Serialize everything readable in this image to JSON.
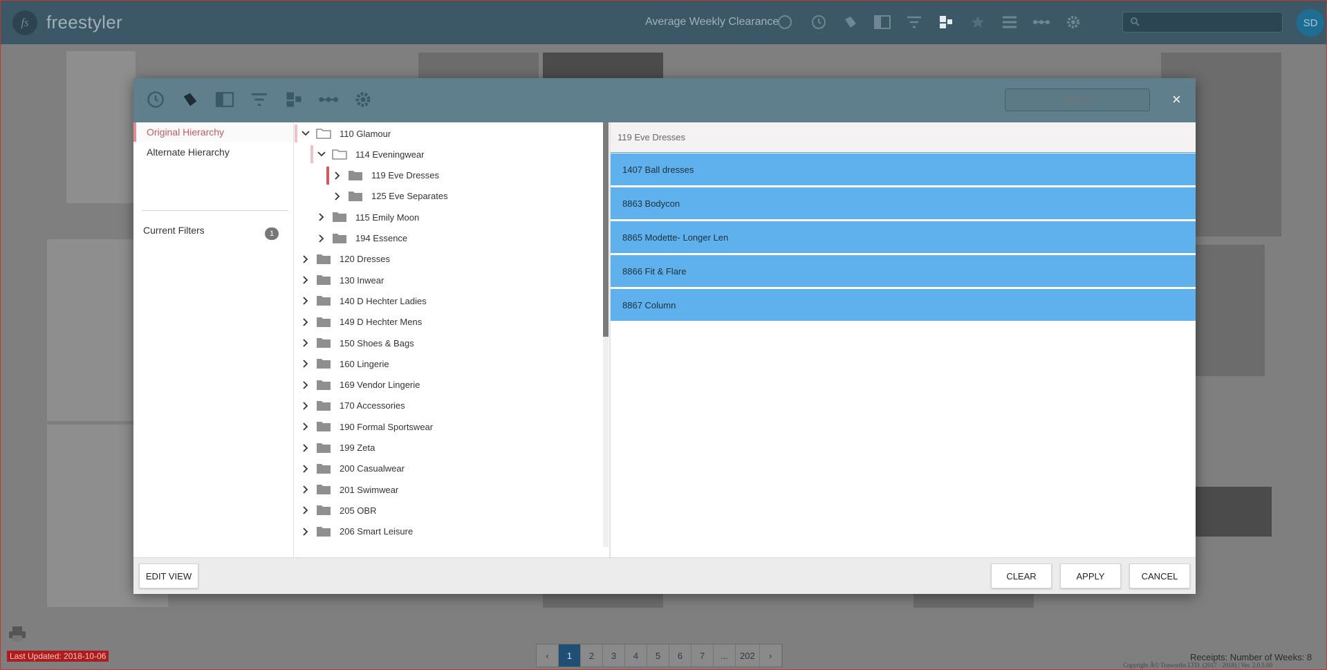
{
  "app": {
    "logo_text": "fs",
    "title": "freestyler",
    "metric_label": "Average Weekly Clearance",
    "user_initials": "SD"
  },
  "modal": {
    "search_placeholder": "Search",
    "close_label": "×",
    "sidebar": [
      {
        "label": "Original Hierarchy",
        "active": true
      },
      {
        "label": "Alternate Hierarchy",
        "active": false
      }
    ],
    "current_filters_label": "Current Filters",
    "current_filters_count": "1",
    "tree": [
      {
        "label": "110 Glamour",
        "level": 0,
        "expanded": true
      },
      {
        "label": "114 Eveningwear",
        "level": 1,
        "expanded": true
      },
      {
        "label": "119 Eve Dresses",
        "level": 2,
        "expanded": false,
        "selected": true
      },
      {
        "label": "125 Eve Separates",
        "level": 2,
        "expanded": false
      },
      {
        "label": "115 Emily Moon",
        "level": 1,
        "expanded": false
      },
      {
        "label": "194 Essence",
        "level": 1,
        "expanded": false
      },
      {
        "label": "120 Dresses",
        "level": 0,
        "expanded": false
      },
      {
        "label": "130 Inwear",
        "level": 0,
        "expanded": false
      },
      {
        "label": "140 D Hechter Ladies",
        "level": 0,
        "expanded": false
      },
      {
        "label": "149 D Hechter Mens",
        "level": 0,
        "expanded": false
      },
      {
        "label": "150 Shoes & Bags",
        "level": 0,
        "expanded": false
      },
      {
        "label": "160 Lingerie",
        "level": 0,
        "expanded": false
      },
      {
        "label": "169 Vendor Lingerie",
        "level": 0,
        "expanded": false
      },
      {
        "label": "170 Accessories",
        "level": 0,
        "expanded": false
      },
      {
        "label": "190 Formal Sportswear",
        "level": 0,
        "expanded": false
      },
      {
        "label": "199 Zeta",
        "level": 0,
        "expanded": false
      },
      {
        "label": "200 Casualwear",
        "level": 0,
        "expanded": false
      },
      {
        "label": "201 Swimwear",
        "level": 0,
        "expanded": false
      },
      {
        "label": "205 OBR",
        "level": 0,
        "expanded": false
      },
      {
        "label": "206 Smart Leisure",
        "level": 0,
        "expanded": false
      }
    ],
    "detail_header": "119 Eve Dresses",
    "detail_items": [
      "1407 Ball dresses",
      "8863 Bodycon",
      "8865 Modette- Longer Len",
      "8866 Fit & Flare",
      "8867 Column"
    ],
    "buttons": {
      "edit_view": "EDIT VIEW",
      "clear": "CLEAR",
      "apply": "APPLY",
      "cancel": "CANCEL"
    }
  },
  "footer": {
    "last_updated": "Last Updated: 2018-10-06",
    "pages": [
      "‹",
      "1",
      "2",
      "3",
      "4",
      "5",
      "6",
      "7",
      "...",
      "202",
      "›"
    ],
    "current_page": "1",
    "receipts": "Receipts: Number of Weeks: 8",
    "copyright": "Copyright Â© Truworths LTD. (2017 - 2018) | Ver. 2.0.5.00"
  },
  "colors": {
    "header": "#3c5866",
    "modal_header": "#5f7f8c",
    "selected_item": "#5fb1ee",
    "accent": "#c45a63"
  }
}
